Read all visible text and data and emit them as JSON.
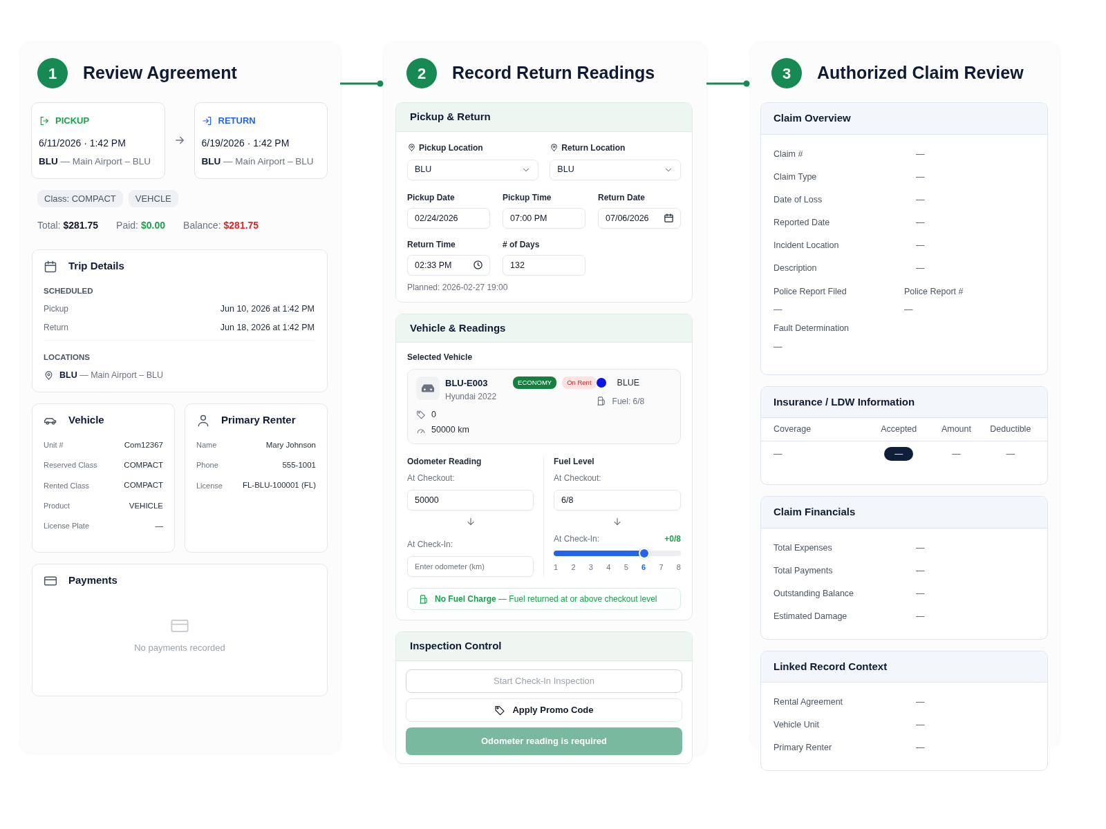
{
  "agreement": {
    "step": "1",
    "title": "Review Agreement",
    "legs": [
      {
        "kind": "pickup",
        "label": "PICKUP",
        "datetime": "6/11/2026 · 1:42 PM",
        "location": "**BLU** — Main Airport – BLU"
      },
      {
        "kind": "return",
        "label": "RETURN",
        "datetime": "6/19/2026 · 1:42 PM",
        "location": "**BLU** — Main Airport – BLU"
      }
    ],
    "tags": [
      "Class: COMPACT",
      "VEHCLE"
    ],
    "totals": [
      {
        "kind": "neutral",
        "label": "Total:",
        "value": "$281.75"
      },
      {
        "kind": "positive",
        "label": "Paid:",
        "value": "$0.00"
      },
      {
        "kind": "negative",
        "label": "Balance:",
        "value": "$281.75"
      }
    ],
    "trip_details": {
      "title": "Trip Details",
      "scheduled_heading": "SCHEDULED",
      "rows": [
        {
          "label": "Pickup",
          "value": "Jun 10, 2026 at 1:42 PM"
        },
        {
          "label": "Return",
          "value": "Jun 18, 2026 at 1:42 PM"
        }
      ],
      "locations_heading": "LOCATIONS",
      "location": "**BLU** — Main Airport – BLU"
    },
    "vehicle": {
      "title": "Vehicle",
      "rows": [
        {
          "label": "Unit #",
          "value": "Com12367"
        },
        {
          "label": "Reserved Class",
          "value": "COMPACT"
        },
        {
          "label": "Rented Class",
          "value": "COMPACT"
        },
        {
          "label": "Product",
          "value": "VEHICLE"
        },
        {
          "label": "License Plate",
          "value": "—"
        }
      ]
    },
    "renter": {
      "title": "Primary Renter",
      "rows": [
        {
          "label": "Name",
          "value": "Mary Johnson"
        },
        {
          "label": "Phone",
          "value": "555-1001"
        },
        {
          "label": "License",
          "value": "FL-BLU-100001 (FL)"
        }
      ]
    },
    "payments": {
      "title": "Payments",
      "empty": "No payments recorded"
    }
  },
  "readings": {
    "step": "2",
    "title": "Record Return Readings",
    "pickup_return": {
      "title": "Pickup & Return",
      "locations": [
        {
          "label": "Pickup Location",
          "value": "BLU"
        },
        {
          "label": "Return Location",
          "value": "BLU"
        }
      ],
      "fields": [
        {
          "kind": "text",
          "label": "Pickup Date",
          "value": "02/24/2026"
        },
        {
          "kind": "text",
          "label": "Pickup Time",
          "value": "07:00 PM"
        },
        {
          "kind": "date",
          "label": "Return Date",
          "value": "07/06/2026"
        },
        {
          "kind": "time",
          "label": "Return Time",
          "value": "02:33 PM"
        },
        {
          "kind": "text",
          "label": "# of Days",
          "value": "132"
        }
      ],
      "planned": "Planned: 2026-02-27 19:00"
    },
    "vehicle_readings": {
      "title": "Vehicle & Readings",
      "selected_label": "Selected Vehicle",
      "vehicle": {
        "unit": "BLU-E003",
        "model": "Hyundai 2022",
        "badges": [
          {
            "kind": "class",
            "text": "ECONOMY"
          },
          {
            "kind": "status",
            "text": "On Rent"
          }
        ],
        "color_name": "BLUE",
        "color": "#0a14e6",
        "tags": "0",
        "mileage": "50000 km",
        "fuel": "Fuel: 6/8"
      },
      "odometer": {
        "title": "Odometer Reading",
        "checkout_label": "At Checkout:",
        "checkout_value": "50000",
        "checkin_label": "At Check-In:",
        "checkin_placeholder": "Enter odometer (km)"
      },
      "fuel": {
        "title": "Fuel Level",
        "checkout_label": "At Checkout:",
        "checkout_value": "6/8",
        "checkin_label": "At Check-In:",
        "delta": "+0/8",
        "level": 0.714,
        "ticks": [
          {
            "label": "1",
            "selected": false
          },
          {
            "label": "2",
            "selected": false
          },
          {
            "label": "3",
            "selected": false
          },
          {
            "label": "4",
            "selected": false
          },
          {
            "label": "5",
            "selected": false
          },
          {
            "label": "6",
            "selected": true
          },
          {
            "label": "7",
            "selected": false
          },
          {
            "label": "8",
            "selected": false
          }
        ]
      },
      "notice": "**No Fuel Charge** — Fuel returned at or above checkout level"
    },
    "inspection": {
      "title": "Inspection Control",
      "buttons": [
        {
          "kind": "outline",
          "label": "Start Check-In Inspection",
          "disabled": true
        },
        {
          "kind": "promo",
          "label": "Apply Promo Code",
          "disabled": false
        },
        {
          "kind": "primary",
          "label": "Odometer reading is required",
          "disabled": true
        }
      ]
    }
  },
  "claim": {
    "step": "3",
    "title": "Authorized Claim Review",
    "overview": {
      "title": "Claim Overview",
      "rows": [
        {
          "label": "Claim #",
          "value": "—"
        },
        {
          "label": "Claim Type",
          "value": "—"
        },
        {
          "label": "Date of Loss",
          "value": "—"
        },
        {
          "label": "Reported Date",
          "value": "—"
        },
        {
          "label": "Incident Location",
          "value": "—"
        },
        {
          "label": "Description",
          "value": "—"
        }
      ],
      "stacked": [
        [
          {
            "label": "Police Report Filed",
            "value": "—"
          },
          {
            "label": "Police Report #",
            "value": "—"
          }
        ],
        [
          {
            "label": "Fault Determination",
            "value": "—"
          }
        ]
      ]
    },
    "insurance": {
      "title": "Insurance / LDW Information",
      "columns": [
        "Coverage",
        "Accepted",
        "Amount",
        "Deductible"
      ],
      "rows": [
        {
          "coverage": "—",
          "accepted": "—",
          "amount": "—",
          "deductible": "—"
        }
      ]
    },
    "financials": {
      "title": "Claim Financials",
      "rows": [
        {
          "label": "Total Expenses",
          "value": "—"
        },
        {
          "label": "Total Payments",
          "value": "—"
        },
        {
          "label": "Outstanding Balance",
          "value": "—"
        },
        {
          "label": "Estimated Damage",
          "value": "—"
        }
      ]
    },
    "linked": {
      "title": "Linked Record Context",
      "rows": [
        {
          "label": "Rental Agreement",
          "value": "—"
        },
        {
          "label": "Vehicle Unit",
          "value": "—"
        },
        {
          "label": "Primary Renter",
          "value": "—"
        }
      ]
    }
  }
}
